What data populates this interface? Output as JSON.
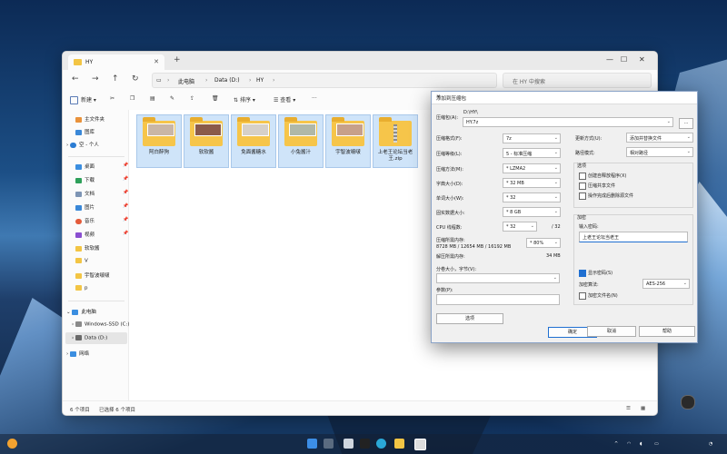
{
  "explorer": {
    "tab_title": "HY",
    "breadcrumb": [
      "此电脑",
      "Data (D:)",
      "HY"
    ],
    "search_placeholder": "在 HY 中搜索",
    "toolbar": {
      "new": "新建",
      "sort": "排序",
      "view": "查看",
      "more": "···"
    },
    "nav": {
      "home": "主文件夹",
      "gallery": "图库",
      "onedrive": "空 - 个人",
      "desktop": "桌面",
      "downloads": "下载",
      "documents": "文档",
      "pictures": "图片",
      "music": "音乐",
      "videos": "视频",
      "f1": "软软酱",
      "f2": "V",
      "f3": "宇智波啵啵",
      "f4": "p",
      "thispc": "此电脑",
      "drive_c": "Windows-SSD (C:)",
      "drive_d": "Data (D:)",
      "network": "网络"
    },
    "files": [
      {
        "name": "阿白醉狗"
      },
      {
        "name": "软软酱"
      },
      {
        "name": "免面酱糖水"
      },
      {
        "name": "小兔酱汁"
      },
      {
        "name": "宇智波啵啵"
      },
      {
        "name": "上老王论坛当老王.zip"
      }
    ],
    "status_count": "6 个项目",
    "status_selected": "已选择 6 个项目"
  },
  "dialog": {
    "title": "添加到压缩包",
    "archive_label": "压缩包(A):",
    "archive_path": "D:\\HY\\",
    "archive_name": "HY.7z",
    "browse": "...",
    "format_label": "压缩格式(F):",
    "format_value": "7z",
    "level_label": "压缩等级(L):",
    "level_value": "5 - 标准压缩",
    "method_label": "压缩方法(M):",
    "method_value": "* LZMA2",
    "dict_label": "字典大小(D):",
    "dict_value": "* 32 MB",
    "word_label": "单词大小(W):",
    "word_value": "* 32",
    "solid_label": "固实数据大小:",
    "solid_value": "* 8 GB",
    "threads_label": "CPU 线程数:",
    "threads_value": "* 32",
    "threads_max": "/ 32",
    "mem_label": "压缩所需内存:",
    "mem_value": "8728 MB / 12654 MB / 16192 MB",
    "mem_pct": "* 80%",
    "decomp_label": "解压所需内存:",
    "decomp_value": "34 MB",
    "split_label": "分卷大小，字节(V):",
    "params_label": "参数(P):",
    "options_btn": "选项",
    "update_label": "更新方式(U):",
    "update_value": "添加并替换文件",
    "path_label": "路径模式:",
    "path_value": "相对路径",
    "options_title": "选项",
    "opt_sfx": "创建自释放程序(X)",
    "opt_shared": "压缩共享文件",
    "opt_delete": "操作完成后删除源文件",
    "enc_title": "加密",
    "pwd_label": "输入密码:",
    "pwd_value": "上老王论坛当老王",
    "show_pwd": "显示密码(S)",
    "enc_method_label": "加密算法:",
    "enc_method_value": "AES-256",
    "enc_names": "加密文件名(N)",
    "ok": "确定",
    "cancel": "取消",
    "help": "帮助"
  }
}
